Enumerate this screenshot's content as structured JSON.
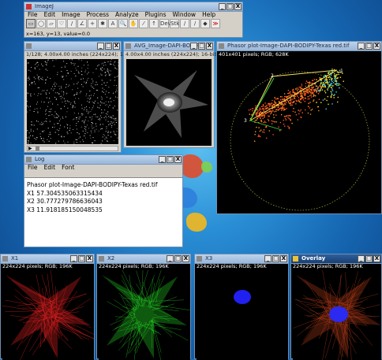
{
  "colors": {
    "title_active": "#1c3f70",
    "title_inactive": "#a8c2e0",
    "desktop": "#1d6fb6"
  },
  "imagej": {
    "title": "ImageJ",
    "menu": [
      "File",
      "Edit",
      "Image",
      "Process",
      "Analyze",
      "Plugins",
      "Window",
      "Help"
    ],
    "tools": [
      "rectangle-tool",
      "oval-tool",
      "polygon-tool",
      "freehand-tool",
      "straight-line-tool",
      "angle-tool",
      "point-tool",
      "wand-tool",
      "text-tool",
      "magnifier-tool",
      "hand-tool",
      "dropper-tool",
      "arrow-tool",
      "dev-tool",
      "stk-tool",
      "brush-tool",
      "pencil-tool",
      "flood-fill-tool",
      "more-tools"
    ],
    "tool_labels": [
      "▭",
      "◯",
      "▱",
      "♡",
      "/",
      "∠",
      "+",
      "✱",
      "A",
      "🔍",
      "✋",
      "⁄",
      "↑",
      "Dev",
      "Stk",
      "∕",
      "∕",
      "◆",
      "≫"
    ],
    "status": "x=163, y=13, value=0.0"
  },
  "stack_win": {
    "title": "",
    "info": "1/128; 4.00x4.00 inches (224x224); 16-bit;"
  },
  "ave_win": {
    "title": "AVG_Image-DAPI-BODIP",
    "info": "4.00x4.00 inches (224x224); 16-bit; 98K"
  },
  "phasor_win": {
    "title": "Phasor plot-Image-DAPI-BODIPY-Texas red.tif",
    "info": "401x401 pixels; RGB; 628K",
    "labels": [
      "1",
      "2",
      "3"
    ]
  },
  "log_win": {
    "title": "Log",
    "menu": [
      "File",
      "Edit",
      "Font"
    ],
    "lines": [
      "Phasor plot-Image-DAPI-BODIPY-Texas red.tif",
      "X1  57.304535063315434",
      "X2  30.777279786636043",
      "X3  11.918185150048535"
    ]
  },
  "x1_win": {
    "title": "X1",
    "info": "224x224 pixels; RGB; 196K"
  },
  "x2_win": {
    "title": "X2",
    "info": "224x224 pixels; RGB; 196K"
  },
  "x3_win": {
    "title": "X3",
    "info": "224x224 pixels; RGB; 196K"
  },
  "overlay_win": {
    "title": "Overlay",
    "info": "224x224 pixels; RGB; 196K"
  },
  "wbtn_labels": {
    "min": "_",
    "max": "□",
    "close": "X"
  }
}
